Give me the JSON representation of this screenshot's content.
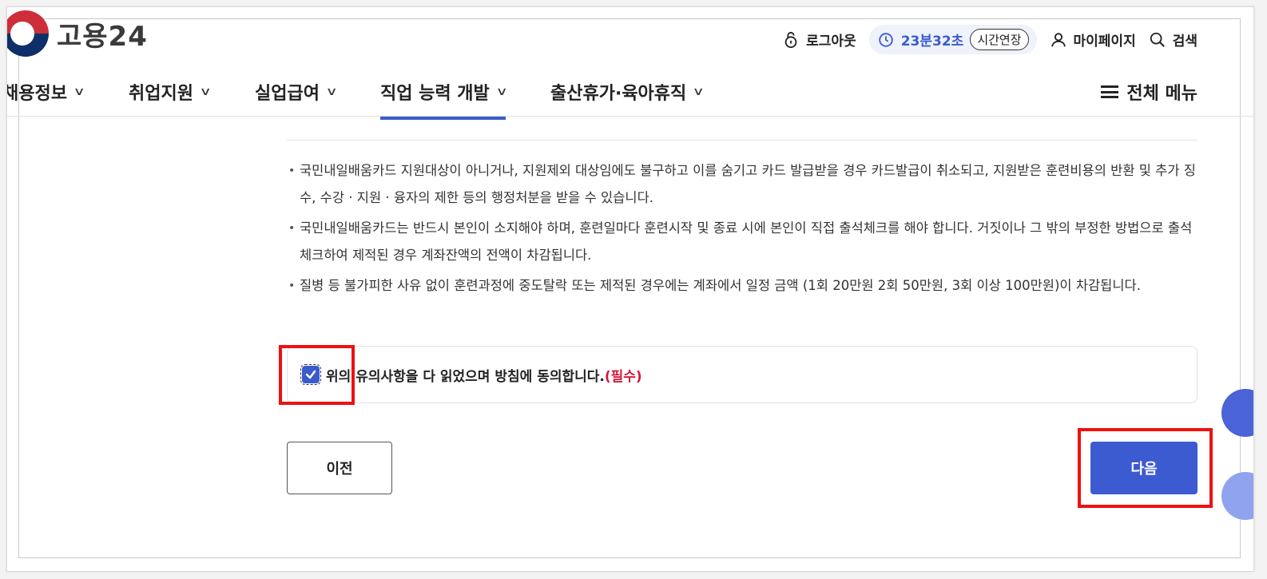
{
  "header": {
    "logo_text": "고용24",
    "logout_label": "로그아웃",
    "timer": "23분32초",
    "extend_label": "시간연장",
    "mypage_label": "마이페이지",
    "search_label": "검색"
  },
  "nav": {
    "items": [
      {
        "label": "채용정보"
      },
      {
        "label": "취업지원"
      },
      {
        "label": "실업급여"
      },
      {
        "label": "직업 능력 개발"
      },
      {
        "label": "출산휴가·육아휴직"
      }
    ],
    "all_menu_label": "전체 메뉴",
    "active_index": 3
  },
  "notes": [
    "국민내일배움카드 지원대상이 아니거나, 지원제외 대상임에도 불구하고 이를 숨기고 카드 발급받을 경우 카드발급이 취소되고, 지원받은 훈련비용의 반환 및 추가 징수, 수강 · 지원 · 융자의 제한 등의 행정처분을 받을 수 있습니다.",
    "국민내일배움카드는 반드시 본인이 소지해야 하며, 훈련일마다 훈련시작 및 종료 시에 본인이 직접 출석체크를 해야 합니다. 거짓이나 그 밖의 부정한 방법으로 출석 체크하여 제적된 경우 계좌잔액의 전액이 차감됩니다.",
    "질병 등 불가피한 사유 없이 훈련과정에 중도탈락 또는 제적된 경우에는 계좌에서 일정 금액 (1회 20만원 2회 50만원, 3회 이상 100만원)이 차감됩니다."
  ],
  "agreement": {
    "label": "위의 유의사항을 다 읽었으며 방침에 동의합니다.",
    "required": "(필수)",
    "checked": true
  },
  "buttons": {
    "prev": "이전",
    "next": "다음"
  },
  "colors": {
    "accent": "#3d5bd1",
    "highlight": "#ee1111",
    "required": "#d11a3c"
  }
}
